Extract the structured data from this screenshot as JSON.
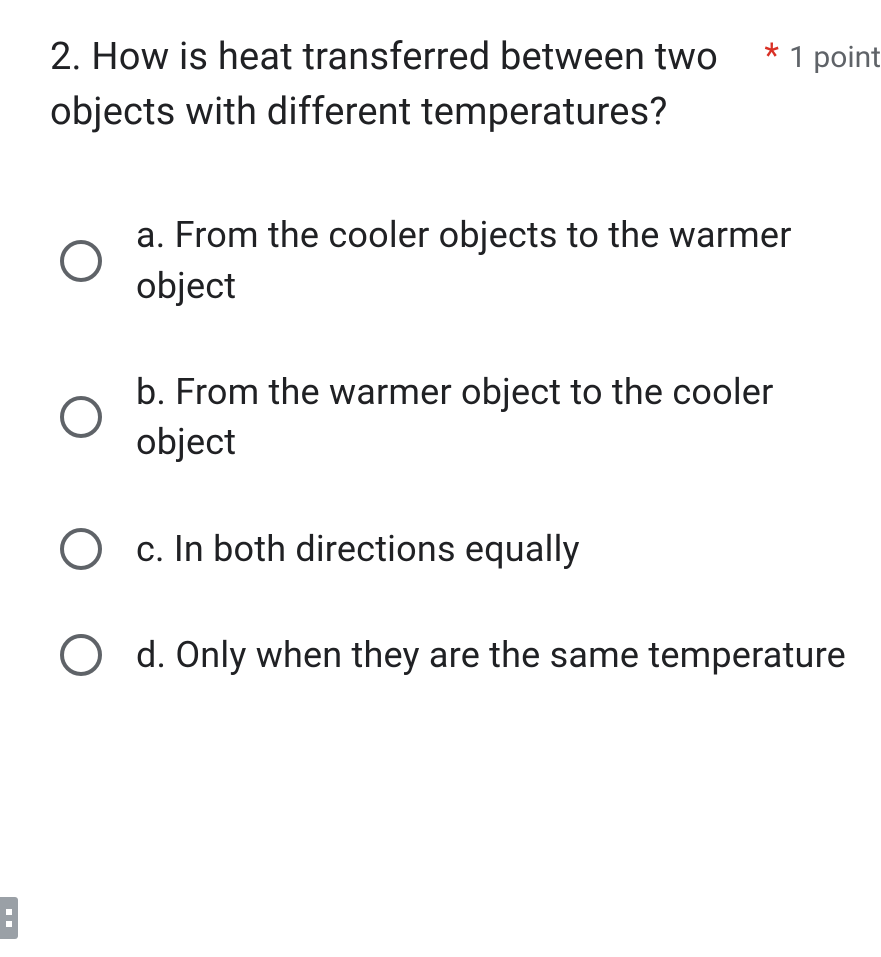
{
  "question": {
    "number": "2.",
    "text": "2. How is heat transferred between two objects with different temperatures?",
    "required_mark": "*",
    "points_label": "1 point"
  },
  "options": [
    {
      "label": "a. From the cooler objects to the warmer object"
    },
    {
      "label": "b. From the warmer object to the cooler object"
    },
    {
      "label": "c. In both directions equally"
    },
    {
      "label": "d. Only when they are the same temperature"
    }
  ]
}
